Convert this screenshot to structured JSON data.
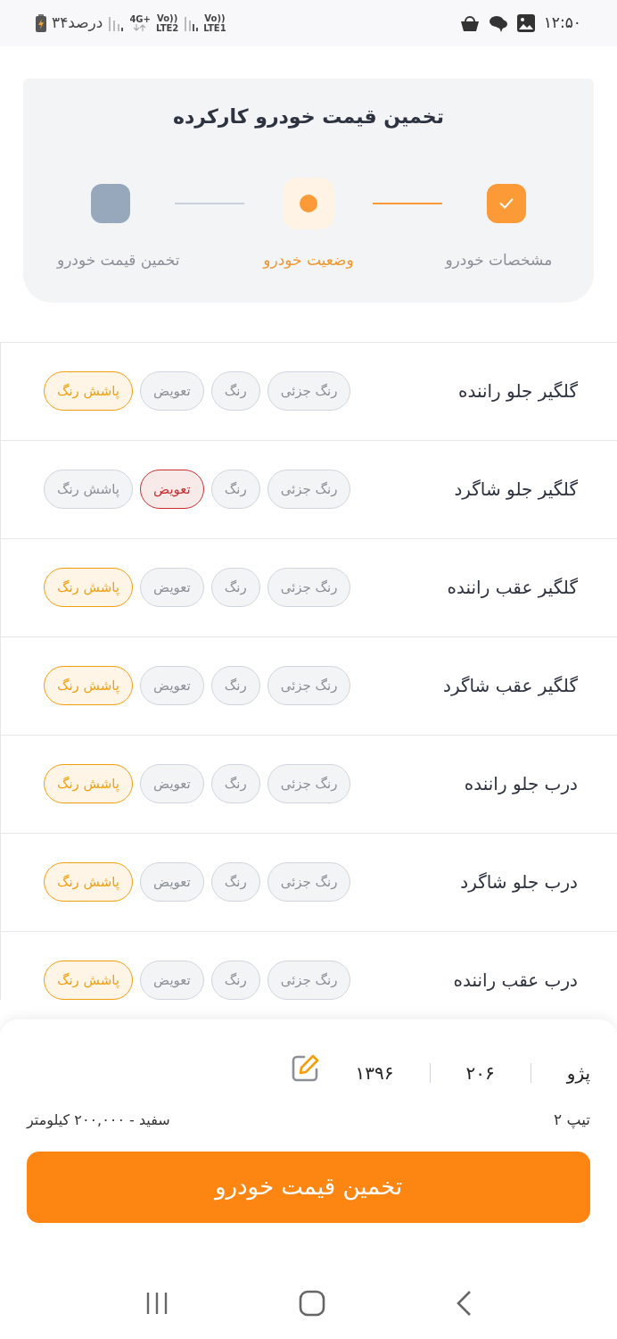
{
  "status_bar": {
    "time": "۱۲:۵۰",
    "battery": "۳۴درصد",
    "network_1": "4G+",
    "network_1_sub": "LTE2",
    "network_2": "Vo))",
    "network_2_sub": "LTE1",
    "network_1_volte": "Vo))"
  },
  "header": {
    "title": "تخمین قیمت خودرو کارکرده",
    "steps": [
      {
        "label": "مشخصات خودرو",
        "completed": true,
        "selected": false
      },
      {
        "label": "وضعیت خودرو",
        "completed": false,
        "selected": true
      },
      {
        "label": "تخمین قیمت خودرو",
        "completed": false,
        "selected": false
      }
    ]
  },
  "parts": [
    {
      "name": "گلگیر جلو راننده",
      "options": [
        {
          "label": "رنگ جزئی",
          "selected": false
        },
        {
          "label": "رنگ",
          "selected": false
        },
        {
          "label": "تعویض",
          "selected": false
        },
        {
          "label": "پاشش رنگ",
          "selected": true,
          "color": "#f59e0b"
        }
      ]
    },
    {
      "name": "گلگیر جلو شاگرد",
      "options": [
        {
          "label": "رنگ جزئی",
          "selected": false
        },
        {
          "label": "رنگ",
          "selected": false
        },
        {
          "label": "تعویض",
          "selected": true,
          "color": "#c53030"
        },
        {
          "label": "پاشش رنگ",
          "selected": false
        }
      ]
    },
    {
      "name": "گلگیر عقب راننده",
      "options": [
        {
          "label": "رنگ جزئی",
          "selected": false
        },
        {
          "label": "رنگ",
          "selected": false
        },
        {
          "label": "تعویض",
          "selected": false
        },
        {
          "label": "پاشش رنگ",
          "selected": true,
          "color": "#f59e0b"
        }
      ]
    },
    {
      "name": "گلگیر عقب شاگرد",
      "options": [
        {
          "label": "رنگ جزئی",
          "selected": false
        },
        {
          "label": "رنگ",
          "selected": false
        },
        {
          "label": "تعویض",
          "selected": false
        },
        {
          "label": "پاشش رنگ",
          "selected": true,
          "color": "#f59e0b"
        }
      ]
    },
    {
      "name": "درب جلو راننده",
      "options": [
        {
          "label": "رنگ جزئی",
          "selected": false
        },
        {
          "label": "رنگ",
          "selected": false
        },
        {
          "label": "تعویض",
          "selected": false
        },
        {
          "label": "پاشش رنگ",
          "selected": true,
          "color": "#f59e0b"
        }
      ]
    },
    {
      "name": "درب جلو شاگرد",
      "options": [
        {
          "label": "رنگ جزئی",
          "selected": false
        },
        {
          "label": "رنگ",
          "selected": false
        },
        {
          "label": "تعویض",
          "selected": false
        },
        {
          "label": "پاشش رنگ",
          "selected": true,
          "color": "#f59e0b"
        }
      ]
    },
    {
      "name": "درب عقب راننده",
      "options": [
        {
          "label": "رنگ جزئی",
          "selected": false
        },
        {
          "label": "رنگ",
          "selected": false
        },
        {
          "label": "تعویض",
          "selected": false
        },
        {
          "label": "پاشش رنگ",
          "selected": true,
          "color": "#f59e0b"
        }
      ]
    }
  ],
  "summary": {
    "brand": "پژو",
    "model": "۲۰۶",
    "year": "۱۳۹۶",
    "trim": "تیپ ۲",
    "details": "سفید - ۲۰۰,۰۰۰ کیلومتر"
  },
  "estimate_button": "تخمین قیمت خودرو"
}
